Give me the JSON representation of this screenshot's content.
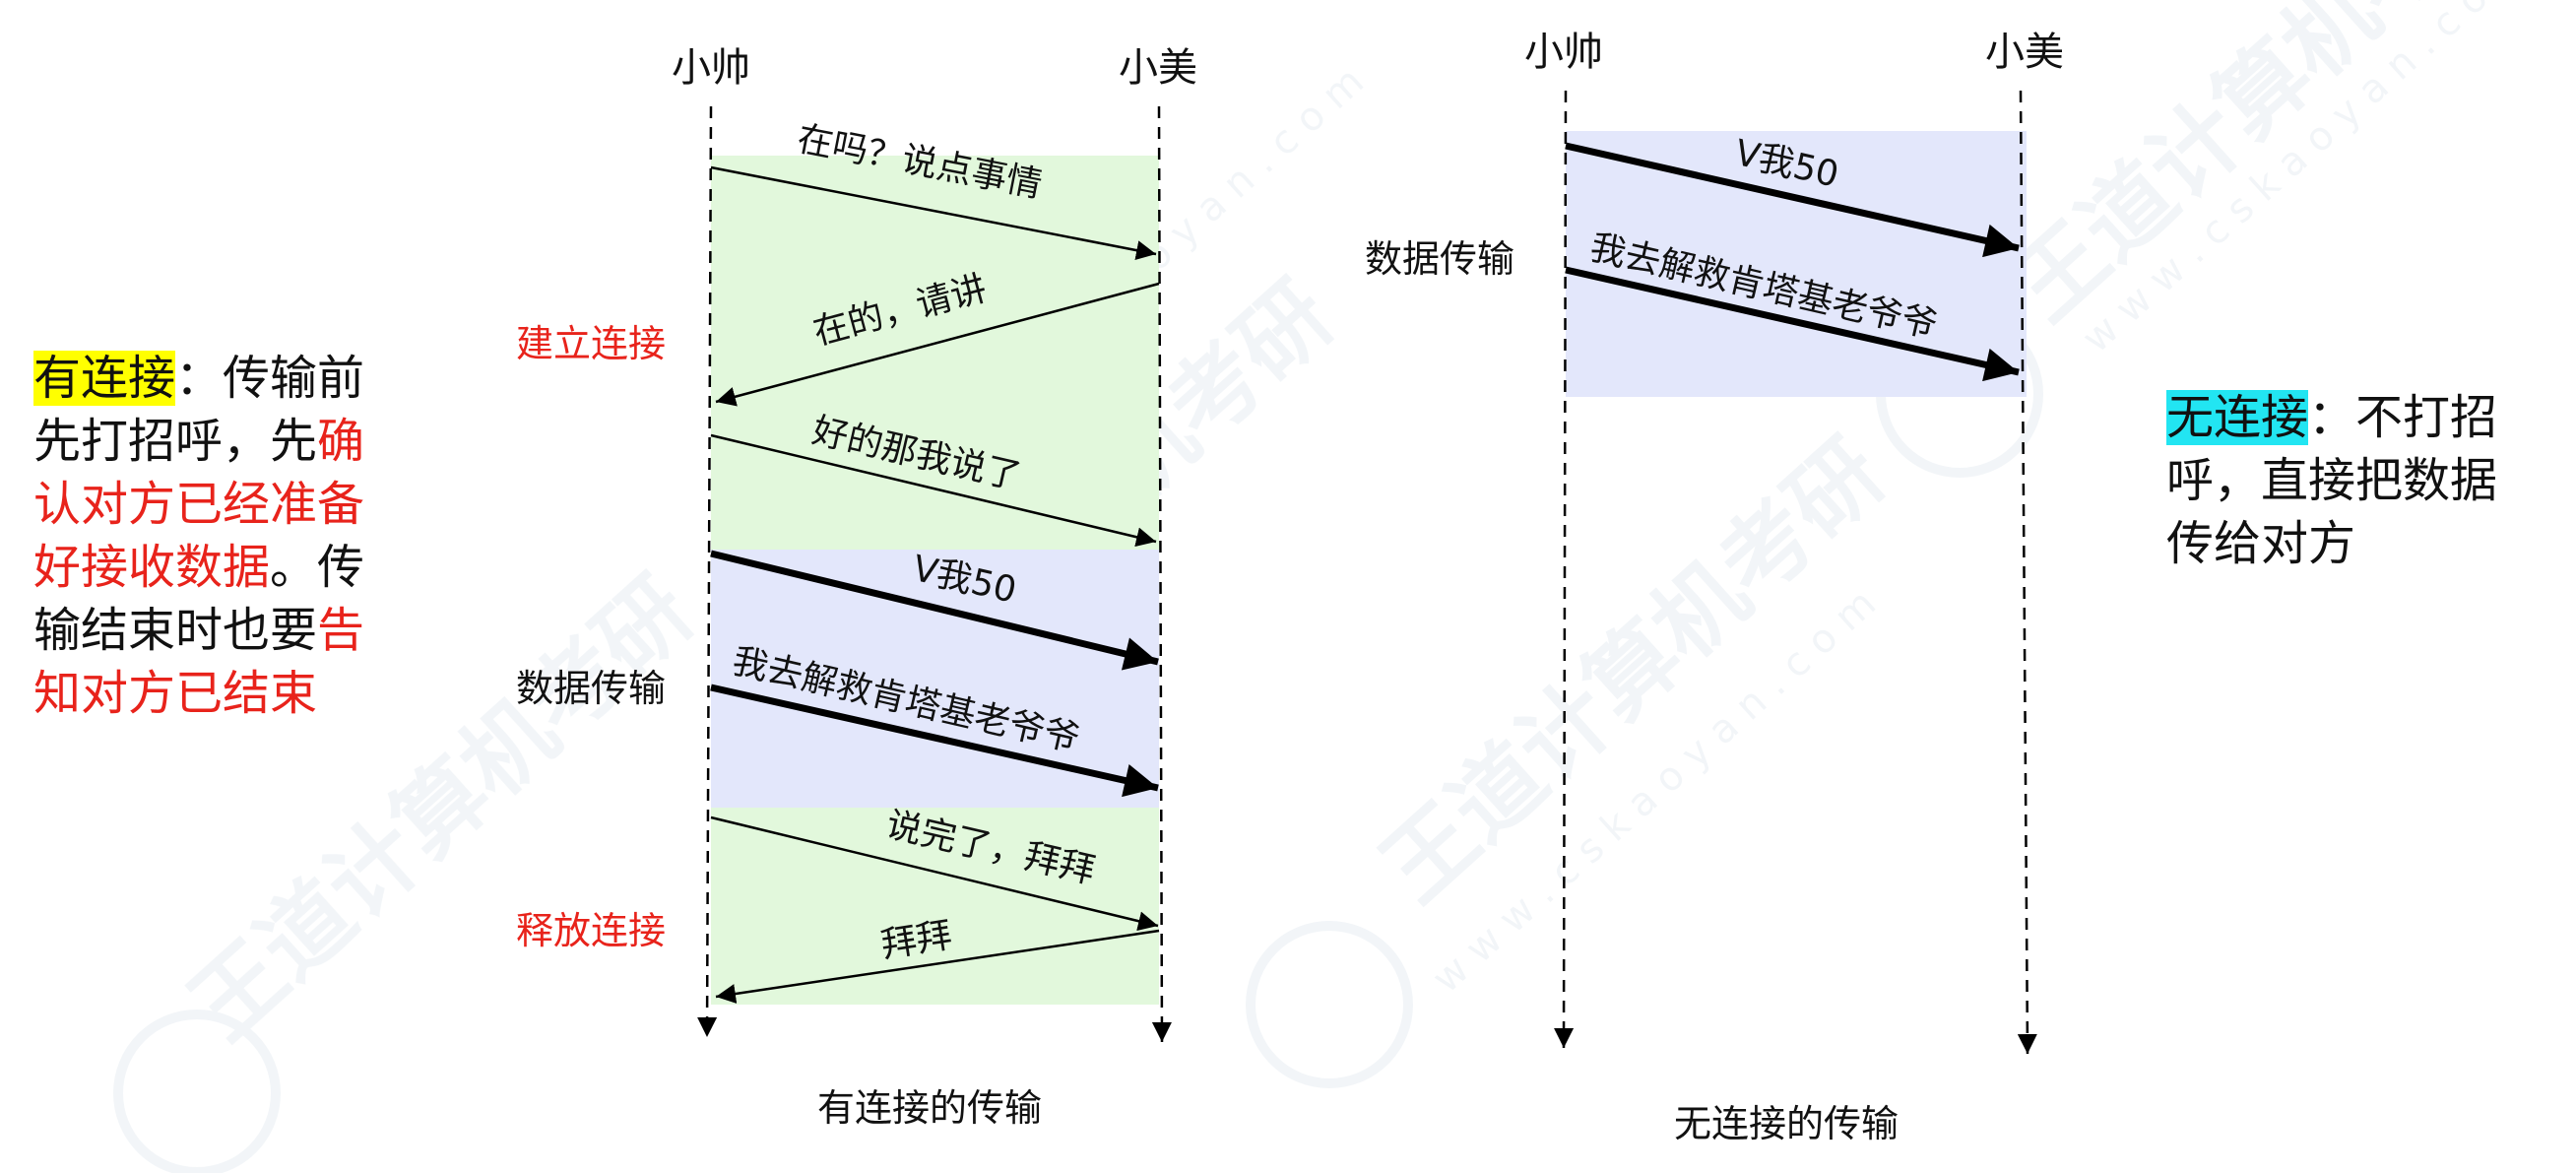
{
  "left_note": {
    "highlight": "有连接",
    "colon": "：",
    "line1_rest": "传输前",
    "line2_black": "先打招呼，先",
    "line2_red": "确",
    "line3_red": "认对方已经准备",
    "line4_red": "好接收数据",
    "line4_black": "。传",
    "line5_black": "输结束时也要",
    "line5_red": "告",
    "line6_red": "知对方已结束"
  },
  "right_note": {
    "highlight": "无连接",
    "colon": "：",
    "line1_rest": "不打招",
    "line2": "呼，直接把数据",
    "line3": "传给对方"
  },
  "connected": {
    "sender": "小帅",
    "receiver": "小美",
    "caption": "有连接的传输",
    "phase_setup": "建立连接",
    "phase_data": "数据传输",
    "phase_release": "释放连接",
    "msg1": "在吗？说点事情",
    "msg2": "在的，请讲",
    "msg3": "好的那我说了",
    "msg4": "V我50",
    "msg5": "我去解救肯塔基老爷爷",
    "msg6": "说完了，拜拜",
    "msg7": "拜拜"
  },
  "connectionless": {
    "sender": "小帅",
    "receiver": "小美",
    "caption": "无连接的传输",
    "phase_data": "数据传输",
    "msg1": "V我50",
    "msg2": "我去解救肯塔基老爷爷"
  },
  "watermark": {
    "brand": "王道计算机考研",
    "url": "w w w . c s k a o y a n . c o m"
  },
  "colors": {
    "setup_band": "#e2f8dc",
    "data_band": "#e3e7fb",
    "phase_label_red": "#e8231b",
    "highlight_yellow": "#ffff00",
    "highlight_cyan": "#22e5f2"
  }
}
